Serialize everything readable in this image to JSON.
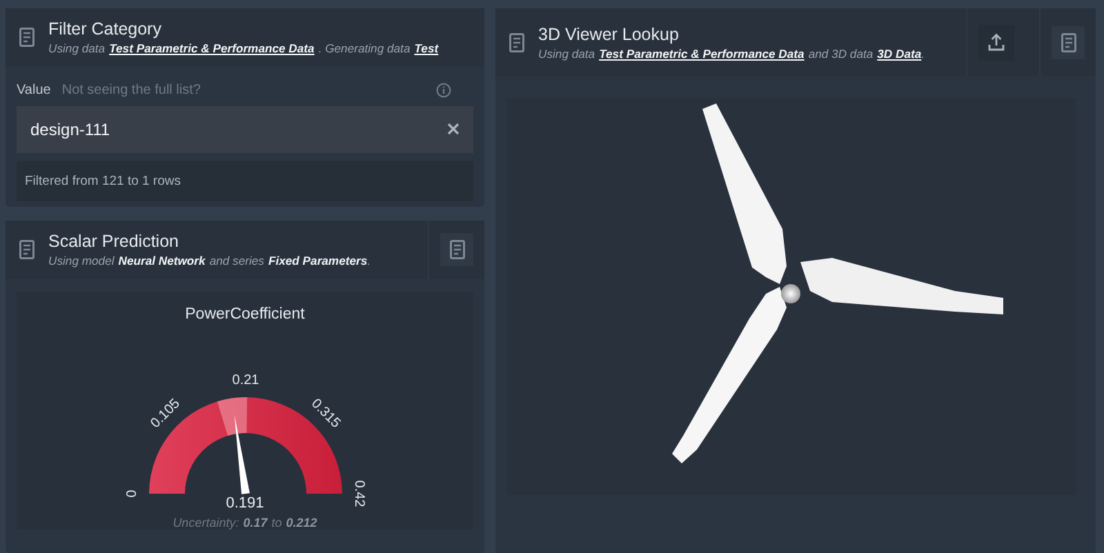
{
  "filter_panel": {
    "title": "Filter Category",
    "subtitle": [
      {
        "kind": "text",
        "text": "Using data"
      },
      {
        "kind": "link",
        "text": "Test Parametric & Performance Data"
      },
      {
        "kind": "text",
        "text": ". Generating data"
      },
      {
        "kind": "link",
        "text": "Test"
      }
    ],
    "field_label": "Value",
    "hint": "Not seeing the full list?",
    "value": "design-111",
    "status": "Filtered from 121 to 1 rows"
  },
  "prediction_panel": {
    "title": "Scalar Prediction",
    "subtitle": [
      {
        "kind": "text",
        "text": "Using model"
      },
      {
        "kind": "bold",
        "text": "Neural Network"
      },
      {
        "kind": "text",
        "text": "and series"
      },
      {
        "kind": "bold",
        "text": "Fixed Parameters"
      },
      {
        "kind": "text",
        "text": "."
      }
    ],
    "gauge": {
      "title": "PowerCoefficient",
      "ticks": [
        "0",
        "0.105",
        "0.21",
        "0.315",
        "0.42"
      ],
      "value": "0.191",
      "level": 0.455,
      "band_low": {
        "level": 0.405
      },
      "band_high": {
        "level": 0.505
      },
      "uncertainty": [
        {
          "kind": "text",
          "text": "Uncertainty:"
        },
        {
          "kind": "bold",
          "text": "0.17"
        },
        {
          "kind": "text",
          "text": "to"
        },
        {
          "kind": "bold",
          "text": "0.212"
        }
      ]
    }
  },
  "viewer_panel": {
    "title": "3D Viewer Lookup",
    "subtitle": [
      {
        "kind": "text",
        "text": "Using data"
      },
      {
        "kind": "link",
        "text": "Test Parametric & Performance Data"
      },
      {
        "kind": "text",
        "text": "and 3D data"
      },
      {
        "kind": "link",
        "text": "3D Data"
      },
      {
        "kind": "text",
        "text": "."
      }
    ]
  }
}
